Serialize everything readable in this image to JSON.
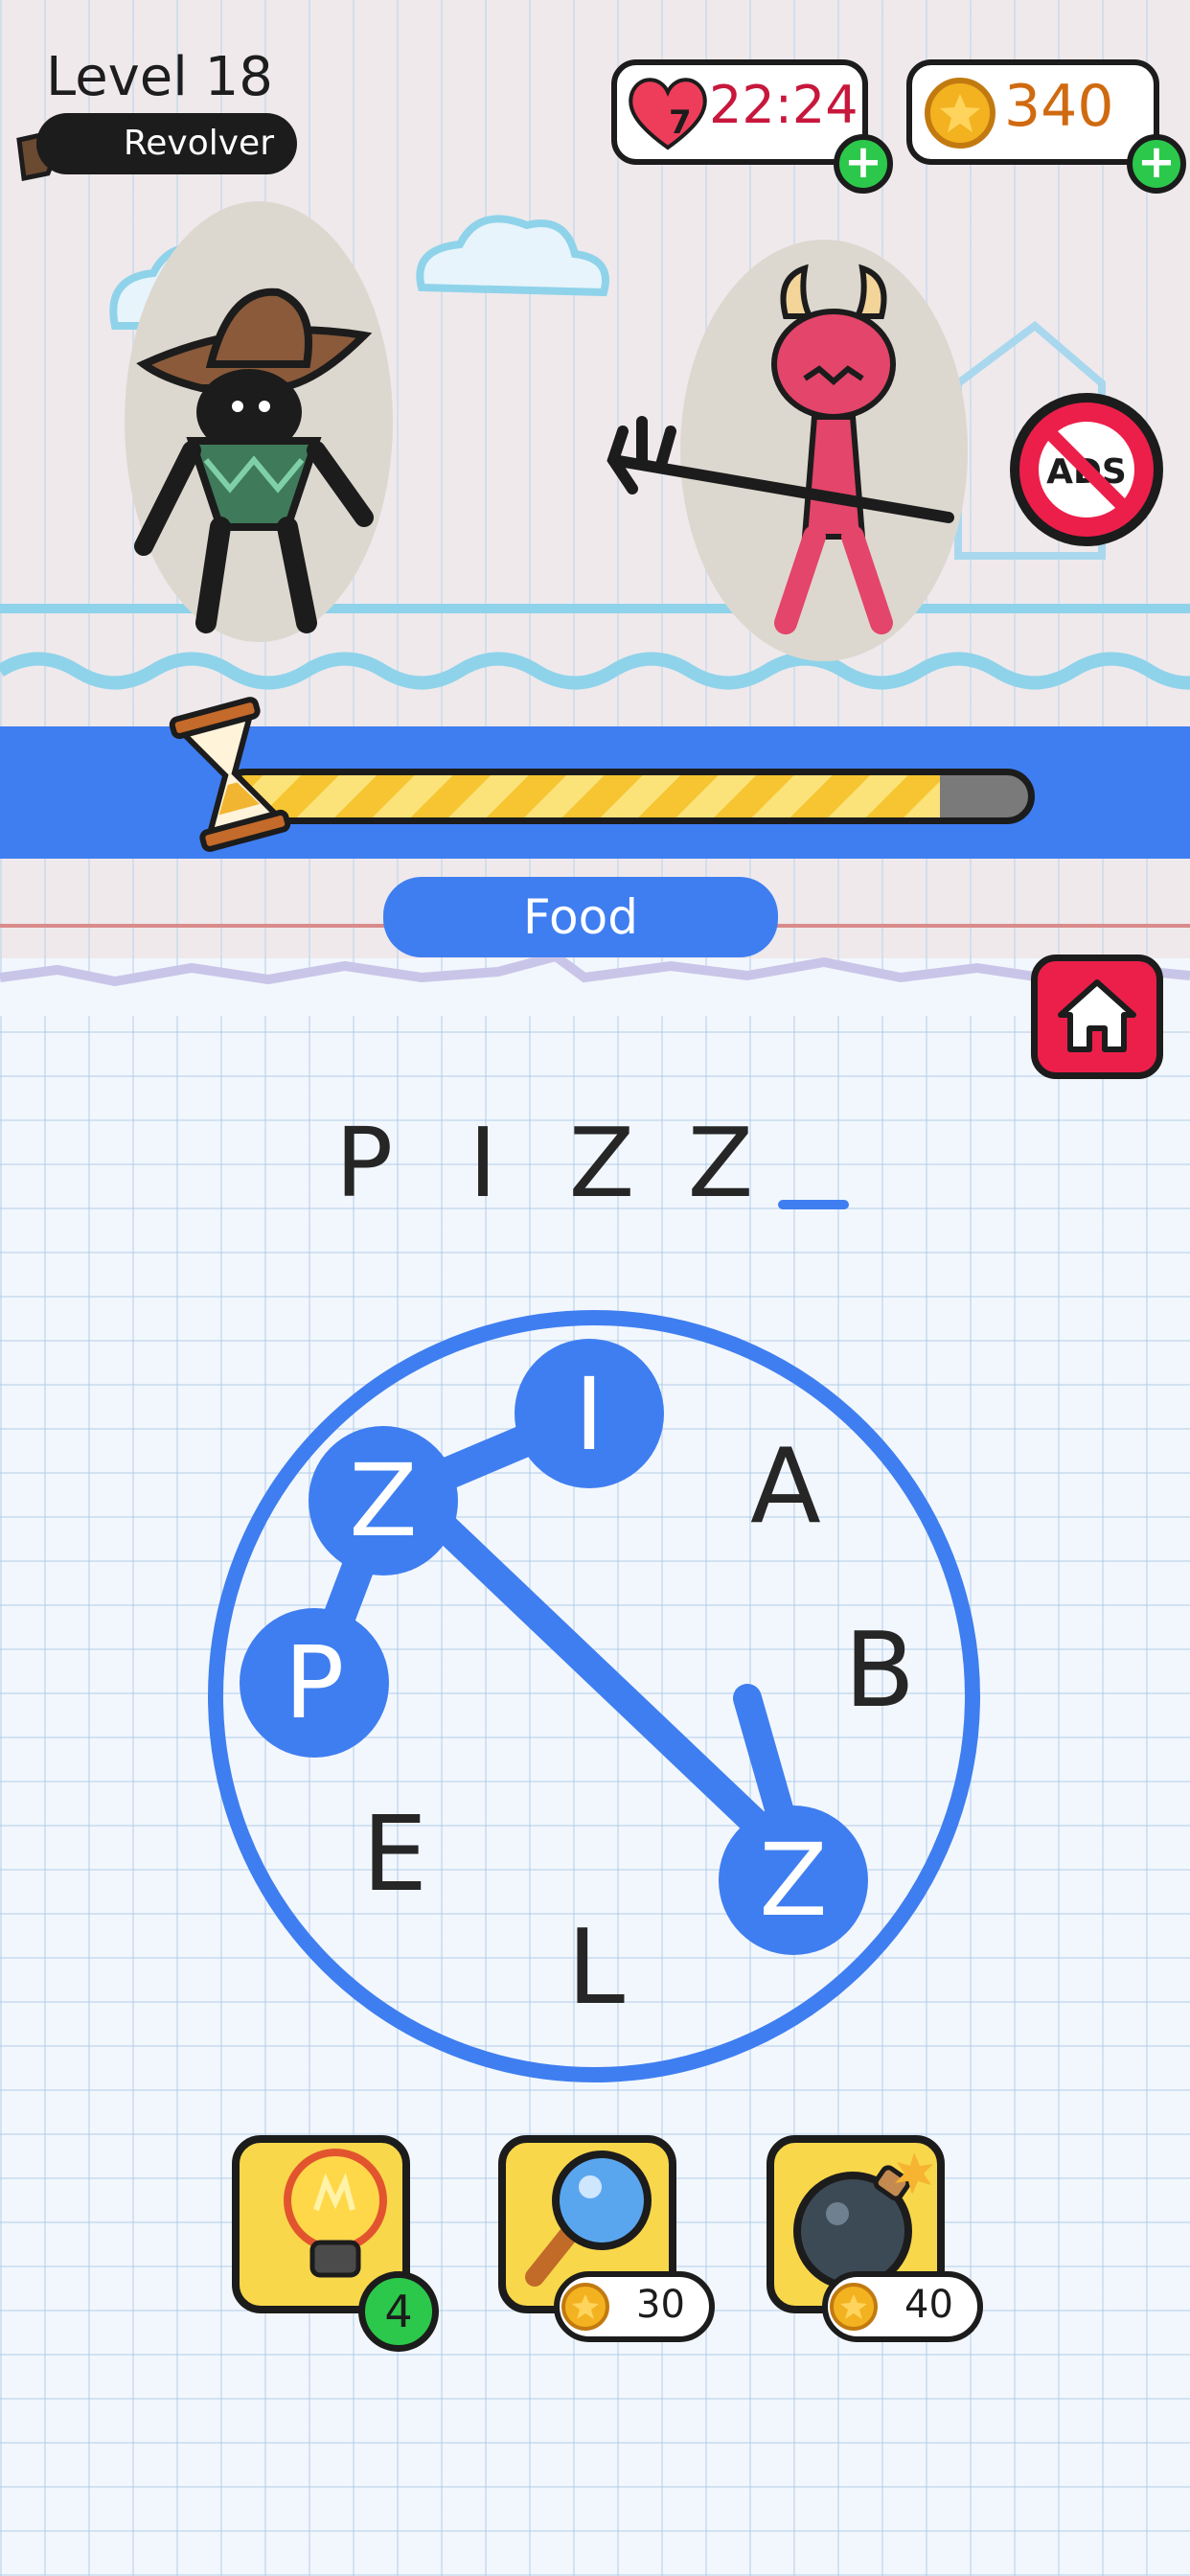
{
  "hud": {
    "level": "Level 18",
    "weapon": "Revolver",
    "lives_count": "7",
    "lives_timer": "22:24",
    "coins": "340"
  },
  "timer": {
    "progress": 0.89
  },
  "category": "Food",
  "answer": {
    "letters": [
      "P",
      "I",
      "Z",
      "Z"
    ],
    "blank_count": 1
  },
  "wheel": {
    "letters": [
      "I",
      "A",
      "B",
      "Z",
      "L",
      "E",
      "P",
      "Z"
    ],
    "selected": [
      "P",
      "Z",
      "I",
      "Z"
    ]
  },
  "powerups": {
    "hint_count": "4",
    "find_price": "30",
    "bomb_price": "40"
  },
  "colors": {
    "accent": "#3f7ef0",
    "danger": "#ec1f4a",
    "coin": "#f3b21f",
    "success": "#2cc84b"
  },
  "icons": [
    "revolver-icon",
    "heart-icon",
    "coin-icon",
    "plus-icon",
    "no-ads-icon",
    "home-icon",
    "hourglass-icon",
    "lightbulb-icon",
    "magnifier-icon",
    "bomb-icon"
  ]
}
